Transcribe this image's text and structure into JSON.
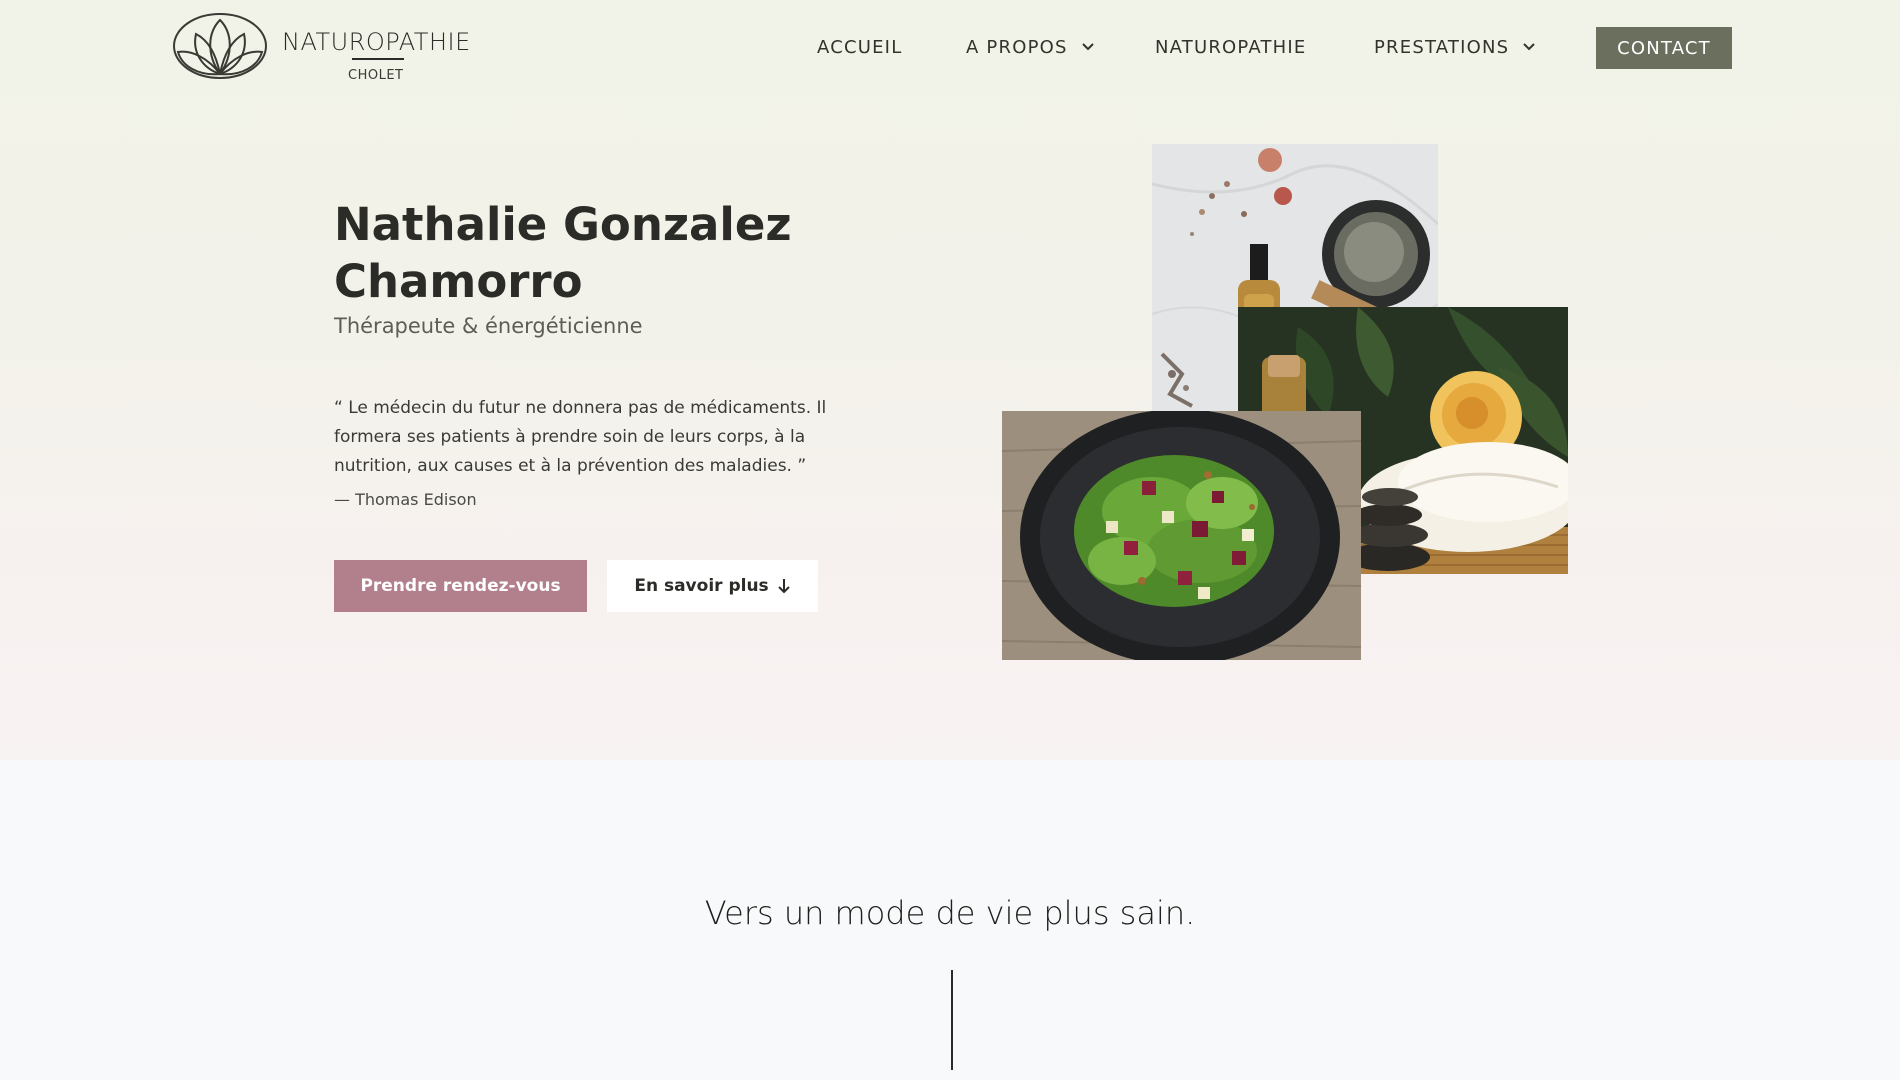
{
  "header": {
    "logo_title": "NATUROPATHIE",
    "logo_subtitle": "CHOLET",
    "logo_icon": "lotus-icon",
    "nav": {
      "accueil": "ACCUEIL",
      "a_propos": "A PROPOS",
      "naturopathie": "NATUROPATHIE",
      "prestations": "PRESTATIONS"
    },
    "contact_label": "CONTACT"
  },
  "hero": {
    "name_line1": "Nathalie Gonzalez",
    "name_line2": "Chamorro",
    "subtitle": "Thérapeute & énergéticienne",
    "quote": "“ Le médecin du futur ne donnera pas de médicaments. Il formera ses patients à prendre soin de leurs corps, à la nutrition, aux causes et à la prévention des maladies. ”",
    "author": "— Thomas Edison",
    "primary_button": "Prendre rendez-vous",
    "secondary_button": "En savoir plus",
    "images": {
      "oils": "essential-oils-photo",
      "spa": "spa-towel-flower-photo",
      "salad": "salad-bowl-photo"
    }
  },
  "section": {
    "title": "Vers un mode de vie plus sain."
  },
  "colors": {
    "accent_pink": "#b27f8c",
    "contact_bg": "#6b6f5e",
    "text_dark": "#2b2b27"
  }
}
